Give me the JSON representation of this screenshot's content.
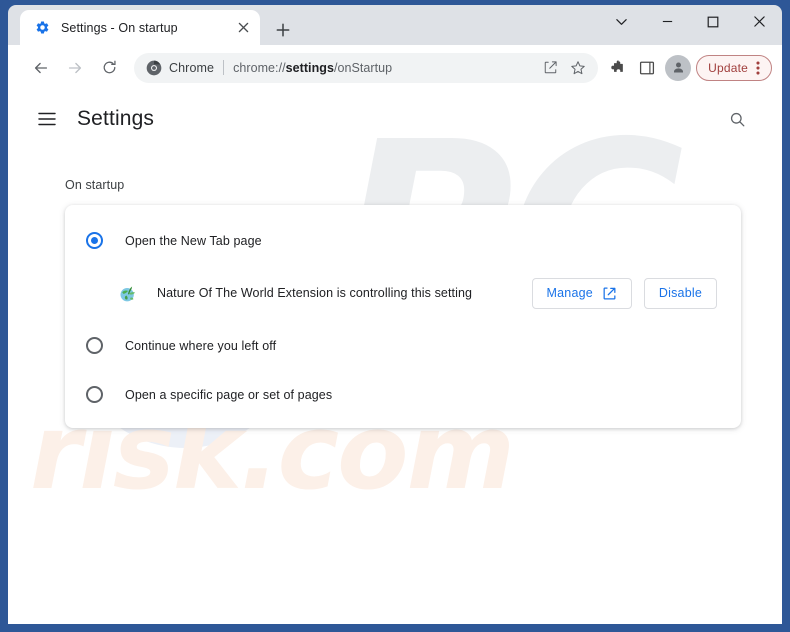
{
  "window": {
    "frame_color": "#2e5797",
    "controls": {
      "tab_search_label": "∨",
      "minimize_label": "–",
      "maximize_label": "□",
      "close_label": "×"
    }
  },
  "tabstrip": {
    "active_tab": {
      "title": "Settings - On startup",
      "favicon": "settings-gear-icon",
      "close": "close-icon"
    },
    "new_tab_label": "+"
  },
  "toolbar": {
    "back_icon": "back-arrow-icon",
    "forward_icon": "forward-arrow-icon",
    "reload_icon": "reload-icon",
    "omnibox": {
      "chrome_icon": "chrome-logo-icon",
      "chrome_label": "Chrome",
      "url_prefix": "chrome://",
      "url_bold": "settings",
      "url_suffix": "/onStartup",
      "share_icon": "share-icon",
      "bookmark_icon": "star-icon"
    },
    "extensions_icon": "puzzle-piece-icon",
    "side_panel_icon": "side-panel-icon",
    "profile_icon": "profile-avatar-icon",
    "update_label": "Update",
    "update_border_color": "#c08383",
    "update_text_color": "#a1403e",
    "menu_icon": "three-dot-menu-icon"
  },
  "settings": {
    "menu_icon": "hamburger-menu-icon",
    "title": "Settings",
    "search_icon": "search-icon",
    "section_label": "On startup",
    "accent_color": "#1a73e8",
    "options": [
      {
        "label": "Open the New Tab page",
        "checked": true
      },
      {
        "label": "Continue where you left off",
        "checked": false
      },
      {
        "label": "Open a specific page or set of pages",
        "checked": false
      }
    ],
    "extension_notice": {
      "icon": "nature-of-the-world-extension-icon",
      "text": "Nature Of The World Extension is controlling this setting",
      "manage_label": "Manage",
      "manage_external_icon": "external-link-icon",
      "disable_label": "Disable"
    }
  },
  "watermarks": {
    "primary": "PC",
    "secondary": "risk.com"
  }
}
